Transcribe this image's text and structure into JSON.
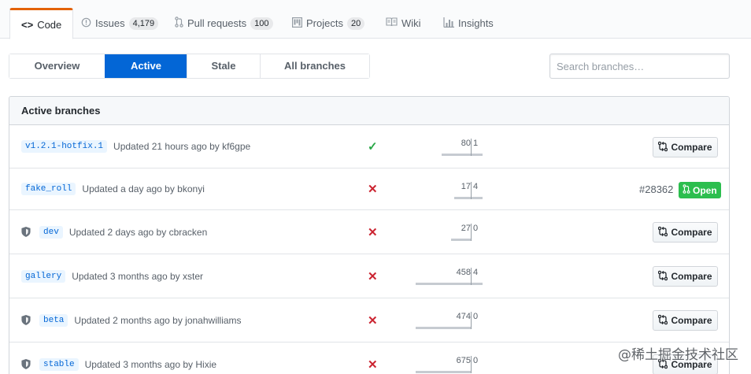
{
  "reponav": {
    "items": [
      {
        "label": "Code",
        "icon": "code-icon",
        "counter": null,
        "selected": true
      },
      {
        "label": "Issues",
        "icon": "issue-icon",
        "counter": "4,179",
        "selected": false
      },
      {
        "label": "Pull requests",
        "icon": "pull-request-icon",
        "counter": "100",
        "selected": false
      },
      {
        "label": "Projects",
        "icon": "project-icon",
        "counter": "20",
        "selected": false
      },
      {
        "label": "Wiki",
        "icon": "book-icon",
        "counter": null,
        "selected": false
      },
      {
        "label": "Insights",
        "icon": "graph-icon",
        "counter": null,
        "selected": false
      }
    ]
  },
  "subnav": {
    "items": [
      {
        "label": "Overview",
        "selected": false
      },
      {
        "label": "Active",
        "selected": true
      },
      {
        "label": "Stale",
        "selected": false
      },
      {
        "label": "All branches",
        "selected": false
      }
    ]
  },
  "search": {
    "placeholder": "Search branches…",
    "value": ""
  },
  "box": {
    "title": "Active branches"
  },
  "branches": [
    {
      "name": "v1.2.1-hotfix.1",
      "updated": "Updated 21 hours ago by kf6gpe",
      "protected": false,
      "status": "success",
      "behind": 80,
      "ahead": 1,
      "action": "compare",
      "compare_label": "Compare"
    },
    {
      "name": "fake_roll",
      "updated": "Updated a day ago by bkonyi",
      "protected": false,
      "status": "failure",
      "behind": 17,
      "ahead": 4,
      "action": "pr",
      "pr_number": "#28362",
      "pr_state": "Open"
    },
    {
      "name": "dev",
      "updated": "Updated 2 days ago by cbracken",
      "protected": true,
      "status": "failure",
      "behind": 27,
      "ahead": 0,
      "action": "compare",
      "compare_label": "Compare"
    },
    {
      "name": "gallery",
      "updated": "Updated 3 months ago by xster",
      "protected": false,
      "status": "failure",
      "behind": 458,
      "ahead": 4,
      "action": "compare",
      "compare_label": "Compare"
    },
    {
      "name": "beta",
      "updated": "Updated 2 months ago by jonahwilliams",
      "protected": true,
      "status": "failure",
      "behind": 474,
      "ahead": 0,
      "action": "compare",
      "compare_label": "Compare"
    },
    {
      "name": "stable",
      "updated": "Updated 3 months ago by Hixie",
      "protected": true,
      "status": "failure",
      "behind": 675,
      "ahead": 0,
      "action": "compare",
      "compare_label": "Compare"
    }
  ],
  "icons": {
    "success": "check-icon",
    "failure": "x-icon",
    "protected": "shield-icon",
    "compare": "compare-icon",
    "pr": "pull-request-icon"
  },
  "colors": {
    "accent": "#0366d6",
    "success": "#28a745",
    "failure": "#cb2431",
    "tab_highlight": "#e36209",
    "pr_open": "#2cbe4e"
  },
  "watermark": "@稀土掘金技术社区"
}
